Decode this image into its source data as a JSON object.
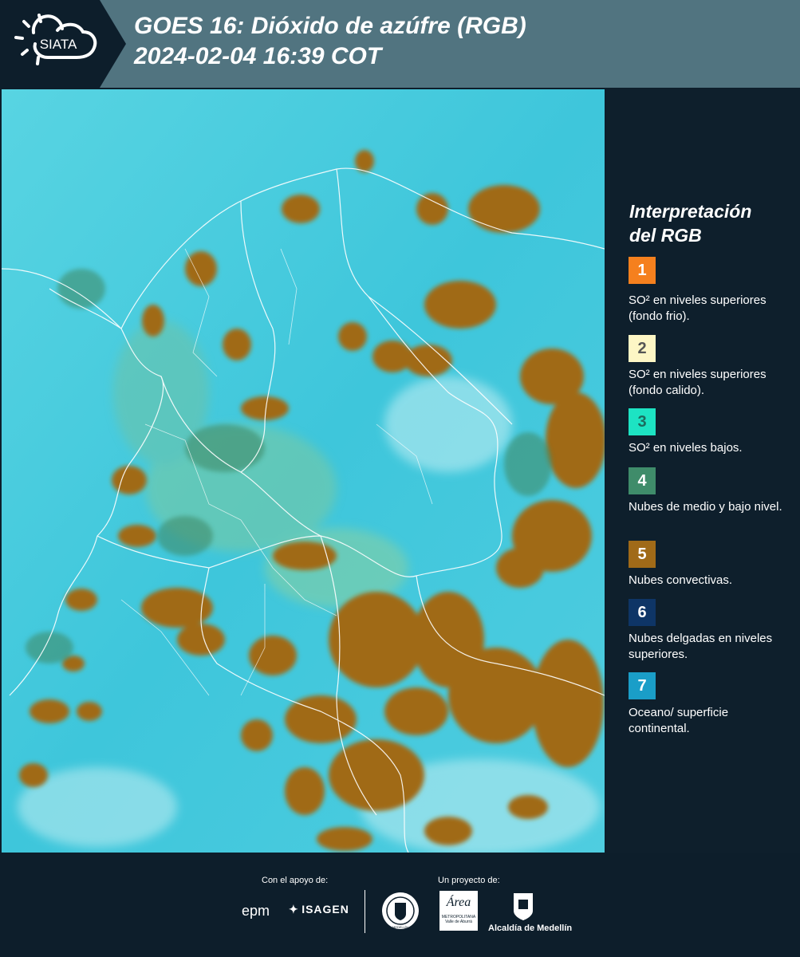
{
  "header": {
    "logo_text": "SIATA",
    "title_line1": "GOES 16: Dióxido de azúfre (RGB)",
    "title_line2": " 2024-02-04 16:39 COT",
    "background": "#517480",
    "logo_bg": "#0d1e2b"
  },
  "legend": {
    "title_line1": "Interpretación",
    "title_line2": "del RGB",
    "items": [
      {
        "number": "1",
        "color": "#f5801e",
        "text_color": "#ffffff",
        "desc": "SO² en niveles superiores (fondo frio)."
      },
      {
        "number": "2",
        "color": "#fdf6c5",
        "text_color": "#555555",
        "desc": "SO² en niveles superiores (fondo calido)."
      },
      {
        "number": "3",
        "color": "#1de3c3",
        "text_color": "#1c6b5e",
        "desc": "SO² en niveles bajos."
      },
      {
        "number": "4",
        "color": "#3f8c6a",
        "text_color": "#ffffff",
        "desc": "Nubes de medio y bajo nivel."
      },
      {
        "number": "5",
        "color": "#a06a18",
        "text_color": "#ffffff",
        "desc": "Nubes convectivas."
      },
      {
        "number": "6",
        "color": "#0e3566",
        "text_color": "#ffffff",
        "desc": "Nubes delgadas en niveles superiores."
      },
      {
        "number": "7",
        "color": "#1a9ec8",
        "text_color": "#ffffff",
        "desc": "Oceano/ superficie continental."
      }
    ]
  },
  "footer": {
    "support_label": "Con el apoyo de:",
    "project_label": "Un proyecto de:",
    "sponsor1": "epm",
    "sponsor2": "ISAGEN",
    "partner1": "MEDELLÍN",
    "partner2": "Área",
    "partner2_sub1": "METROPOLITANA",
    "partner2_sub2": "Valle de Aburrá",
    "partner3": "Alcaldía de Medellín"
  },
  "map": {
    "ocean_color": "#45c8dc",
    "cloud_color": "#a06a18",
    "border_color": "#ffffff"
  }
}
